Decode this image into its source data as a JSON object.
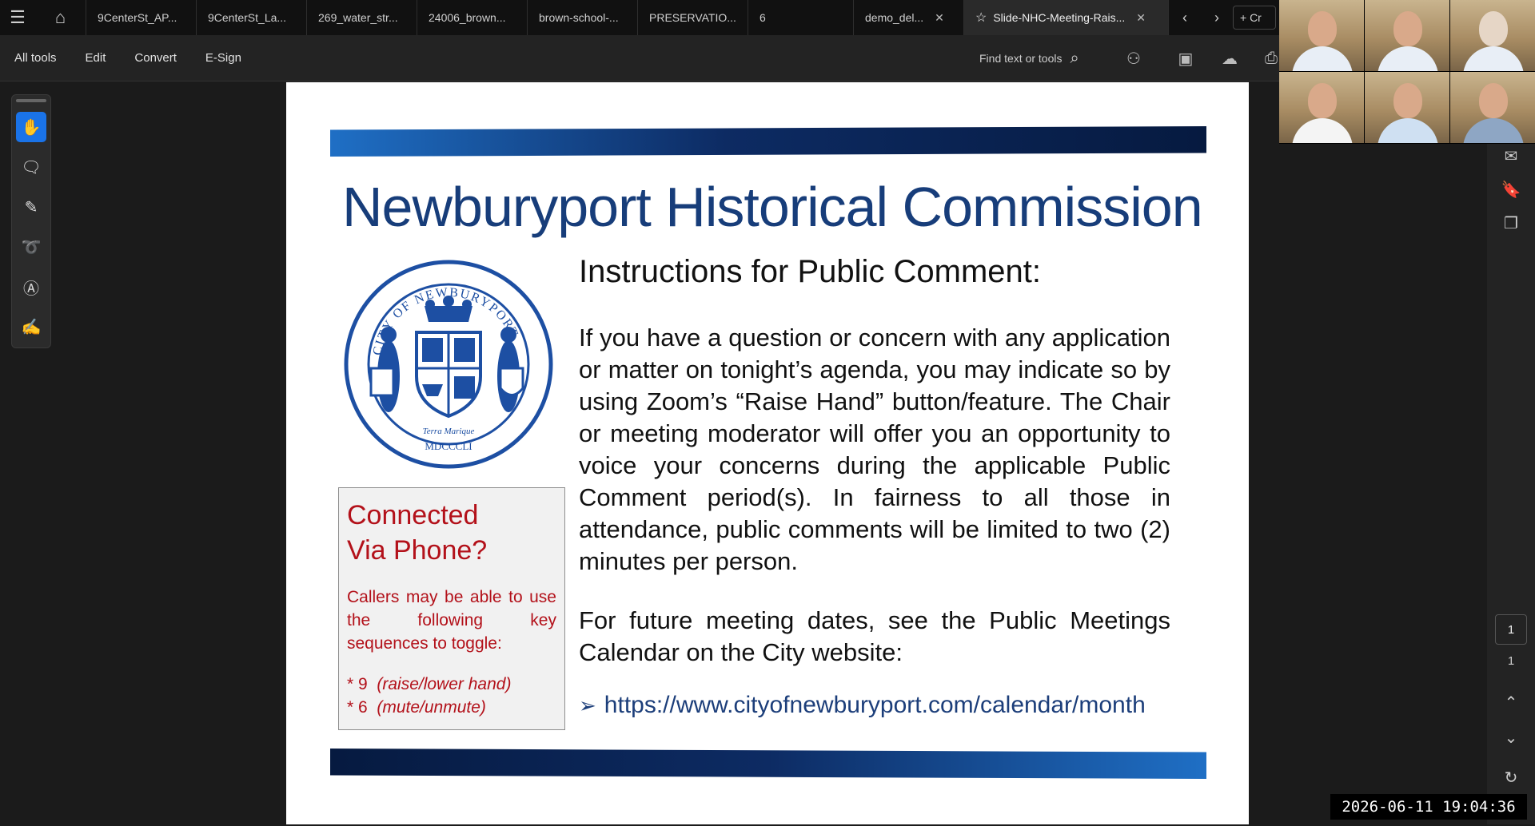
{
  "tabs": [
    {
      "label": "9CenterSt_AP..."
    },
    {
      "label": "9CenterSt_La..."
    },
    {
      "label": "269_water_str..."
    },
    {
      "label": "24006_brown..."
    },
    {
      "label": "brown-school-..."
    },
    {
      "label": "PRESERVATIO..."
    },
    {
      "label": "6"
    },
    {
      "label": "demo_del..."
    },
    {
      "label": "Slide-NHC-Meeting-Rais..."
    }
  ],
  "new_tab_label": "+ Cr",
  "toolbar": {
    "all_tools": "All tools",
    "edit": "Edit",
    "convert": "Convert",
    "esign": "E-Sign",
    "find_text": "Find text or tools"
  },
  "document": {
    "title": "Newburyport Historical Commission",
    "instructions_title": "Instructions for Public Comment:",
    "instructions_body": "If you have a question or concern with any application or matter on tonight’s agenda, you may indicate so by using Zoom’s “Raise Hand” button/feature. The Chair or meeting moderator will offer you an opportunity to voice your concerns during the applicable Public Comment period(s). In fairness to all those in attendance, public comments will be limited to two (2) minutes per person.",
    "future_text": "For future meeting dates, see the Public Meetings Calendar on the City website:",
    "link": "https://www.cityofnewburyport.com/calendar/month",
    "seal_top": "CITY OF NEWBURYPORT",
    "seal_year": "MDCCCLI",
    "seal_motto": "Terra Marique",
    "phone_box": {
      "title_line1": "Connected",
      "title_line2": "Via Phone?",
      "description": "Callers may be able to use the following key sequences to toggle:",
      "key1": "* 9",
      "key1_desc": "(raise/lower hand)",
      "key2": "* 6",
      "key2_desc": "(mute/unmute)"
    }
  },
  "page_nav": {
    "current": "1",
    "total": "1"
  },
  "timestamp": "2026-06-11 19:04:36",
  "colors": {
    "accent_blue": "#1a73e8",
    "title_blue": "#173d7a",
    "phone_red": "#b3111a"
  }
}
